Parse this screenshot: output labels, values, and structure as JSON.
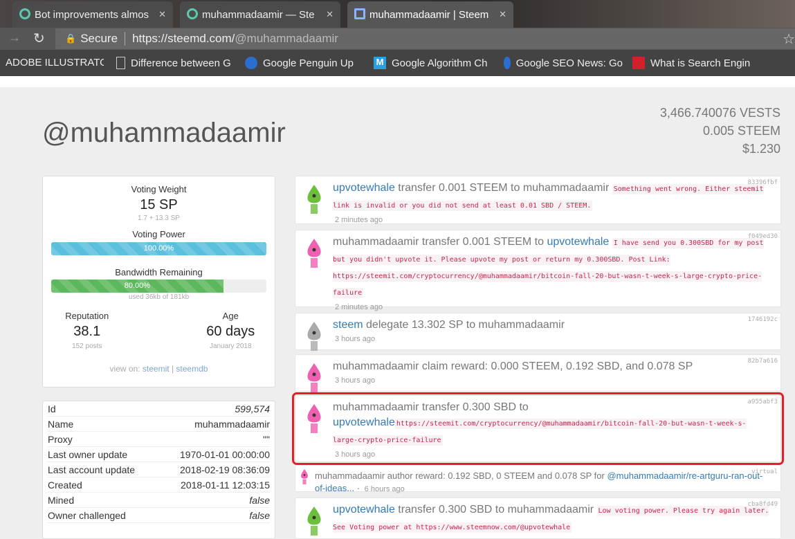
{
  "browser": {
    "tabs": [
      {
        "title": "Bot improvements almos"
      },
      {
        "title": "muhammadaamir — Ste"
      },
      {
        "title": "muhammadaamir | Steem",
        "active": true
      }
    ],
    "secure_label": "Secure",
    "url_host": "https://steemd.com/",
    "url_path": "@muhammadaamir",
    "bookmarks": [
      "ADOBE ILLUSTRATOR",
      "Difference between G",
      "Google Penguin Up",
      "Google Algorithm Ch",
      "Google SEO News: Go",
      "What is Search Engin"
    ]
  },
  "profile": {
    "username": "@muhammadaamir",
    "vests": "3,466.740076 VESTS",
    "steem": "0.005 STEEM",
    "usd": "$1.230"
  },
  "voting": {
    "weight_label": "Voting Weight",
    "weight": "15 SP",
    "weight_detail": "1.7 + 13.3 SP",
    "power_label": "Voting Power",
    "power_text": "100.00%",
    "power_percent": 100,
    "bw_label": "Bandwidth Remaining",
    "bw_text": "80.00%",
    "bw_percent": 80,
    "bw_detail": "used 36kb of 181kb",
    "rep_label": "Reputation",
    "rep": "38.1",
    "posts": "152 posts",
    "age_label": "Age",
    "age": "60 days",
    "age_detail": "January 2018",
    "view_on": "view on:",
    "steemit": "steemit",
    "sep": "|",
    "steemdb": "steemdb",
    "colors": {
      "power": "#5bc0de",
      "bandwidth": "#5cb85c"
    }
  },
  "info": [
    {
      "k": "Id",
      "v": "599,574",
      "i": true
    },
    {
      "k": "Name",
      "v": "muhammadaamir"
    },
    {
      "k": "Proxy",
      "v": "\"\""
    },
    {
      "k": "Last owner update",
      "v": "1970-01-01 00:00:00"
    },
    {
      "k": "Last account update",
      "v": "2018-02-19 08:36:09"
    },
    {
      "k": "Created",
      "v": "2018-01-11 12:03:15"
    },
    {
      "k": "Mined",
      "v": "false",
      "i": true
    },
    {
      "k": "Owner challenged",
      "v": "false",
      "i": true
    }
  ],
  "activity": [
    {
      "avatar": "green-robot",
      "hash": "83396fbf",
      "parts": [
        {
          "text": "upvotewhale",
          "link": true
        },
        {
          "text": " transfer 0.001 STEEM to muhammadaamir "
        }
      ],
      "memo": "Something went wrong. Either steemit link is invalid or you did not send at least 0.01 SBD / STEEM.",
      "time": "2 minutes ago"
    },
    {
      "avatar": "pink-robot",
      "hash": "f049ed30",
      "parts": [
        {
          "text": "muhammadaamir transfer 0.001 STEEM to "
        },
        {
          "text": "upvotewhale",
          "link": true
        },
        {
          "text": " "
        }
      ],
      "memo": "I have send you 0.300SBD for my post but you didn't upvote it. Please upvote my post or return my 0.300SBD. Post Link: https://steemit.com/cryptocurrency/@muhammadaamir/bitcoin-fall-20-but-wasn-t-week-s-large-crypto-price-failure",
      "time": "2 minutes ago"
    },
    {
      "avatar": "gray-robot",
      "hash": "1746192c",
      "parts": [
        {
          "text": "steem",
          "link": true
        },
        {
          "text": " delegate 13.302 SP to muhammadaamir"
        }
      ],
      "time": "3 hours ago"
    },
    {
      "avatar": "pink-robot",
      "hash": "82b7a616",
      "parts": [
        {
          "text": "muhammadaamir claim reward: 0.000 STEEM, 0.192 SBD, and 0.078 SP"
        }
      ],
      "time": "3 hours ago"
    },
    {
      "avatar": "pink-robot",
      "hash": "a955abf3",
      "highlighted": true,
      "parts": [
        {
          "text": "muhammadaamir transfer 0.300 SBD to "
        },
        {
          "text": "upvotewhale",
          "link": true
        }
      ],
      "memo": "https://steemit.com/cryptocurrency/@muhammadaamir/bitcoin-fall-20-but-wasn-t-week-s-large-crypto-price-failure",
      "time": "3 hours ago"
    },
    {
      "avatar": "pink-robot",
      "hash": "virtual",
      "small": true,
      "parts": [
        {
          "text": "muhammadaamir author reward: 0.192 SBD, 0 STEEM and 0.078 SP for "
        },
        {
          "text": "@muhammadaamir/re-artguru-ran-out-of-ideas...",
          "link": true
        },
        {
          "text": " · ",
          "muted": true
        }
      ],
      "time": "6 hours ago"
    },
    {
      "avatar": "green-robot",
      "hash": "cba8fd49",
      "parts": [
        {
          "text": "upvotewhale",
          "link": true
        },
        {
          "text": " transfer 0.300 SBD to muhammadaamir "
        }
      ],
      "memo": "Low voting power. Please try again later. See Voting power at https://www.steemnow.com/@upvotewhale",
      "time": ""
    }
  ]
}
